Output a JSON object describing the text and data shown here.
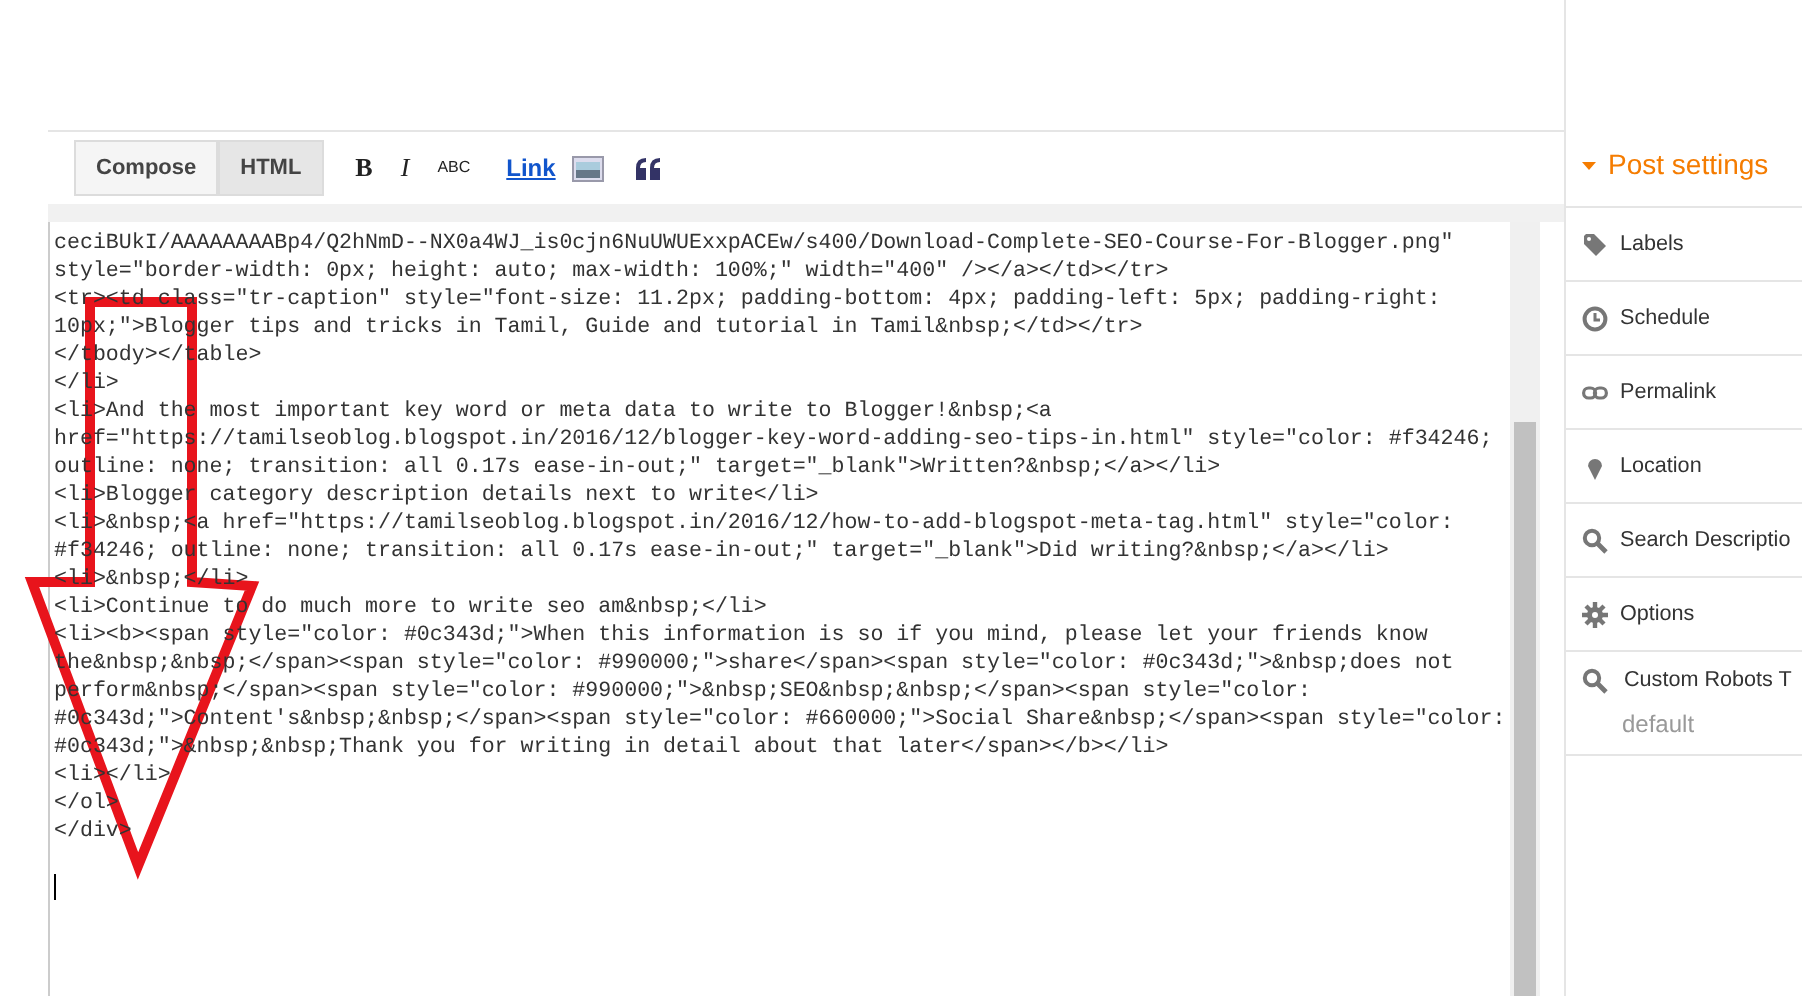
{
  "modes": [
    {
      "label": "Compose",
      "selected": false
    },
    {
      "label": "HTML",
      "selected": true
    }
  ],
  "toolbar": {
    "bold": "B",
    "italic": "I",
    "spellcheck": "ABC",
    "link": "Link"
  },
  "code_lines": [
    "ceciBUkI/AAAAAAAABp4/Q2hNmD--NX0a4WJ_is0cjn6NuUWUExxpACEw/s400/Download-Complete-SEO-Course-For-Blogger.png\"",
    "style=\"border-width: 0px; height: auto; max-width: 100%;\" width=\"400\" /></a></td></tr>",
    "<tr><td class=\"tr-caption\" style=\"font-size: 11.2px; padding-bottom: 4px; padding-left: 5px; padding-right:",
    "10px;\">Blogger tips and tricks in Tamil, Guide and tutorial in Tamil&nbsp;</td></tr>",
    "</tbody></table>",
    "</li>",
    "<li>And the most important key word or meta data to write to Blogger!&nbsp;<a",
    "href=\"https://tamilseoblog.blogspot.in/2016/12/blogger-key-word-adding-seo-tips-in.html\" style=\"color: #f34246;",
    "outline: none; transition: all 0.17s ease-in-out;\" target=\"_blank\">Written?&nbsp;</a></li>",
    "<li>Blogger category description details next to write</li>",
    "<li>&nbsp;<a href=\"https://tamilseoblog.blogspot.in/2016/12/how-to-add-blogspot-meta-tag.html\" style=\"color:",
    "#f34246; outline: none; transition: all 0.17s ease-in-out;\" target=\"_blank\">Did writing?&nbsp;</a></li>",
    "<li>&nbsp;</li>",
    "<li>Continue to do much more to write seo am&nbsp;</li>",
    "<li><b><span style=\"color: #0c343d;\">When this information is so if you mind, please let your friends know",
    "the&nbsp;&nbsp;</span><span style=\"color: #990000;\">share</span><span style=\"color: #0c343d;\">&nbsp;does not",
    "perform&nbsp;</span><span style=\"color: #990000;\">&nbsp;SEO&nbsp;&nbsp;</span><span style=\"color:",
    "#0c343d;\">Content's&nbsp;&nbsp;</span><span style=\"color: #660000;\">Social Share&nbsp;</span><span style=\"color:",
    "#0c343d;\">&nbsp;&nbsp;Thank you for writing in detail about that later</span></b></li>",
    "<li></li>",
    "</ol>",
    "</div>"
  ],
  "sidebar": {
    "title": "Post settings",
    "expanded": true,
    "items": [
      {
        "kind": "tag",
        "label": "Labels"
      },
      {
        "kind": "clock",
        "label": "Schedule"
      },
      {
        "kind": "link",
        "label": "Permalink"
      },
      {
        "kind": "pin",
        "label": "Location"
      },
      {
        "kind": "search",
        "label": "Search Descriptio"
      },
      {
        "kind": "gear",
        "label": "Options"
      },
      {
        "kind": "search",
        "label": "Custom Robots T",
        "value": "default"
      }
    ]
  }
}
